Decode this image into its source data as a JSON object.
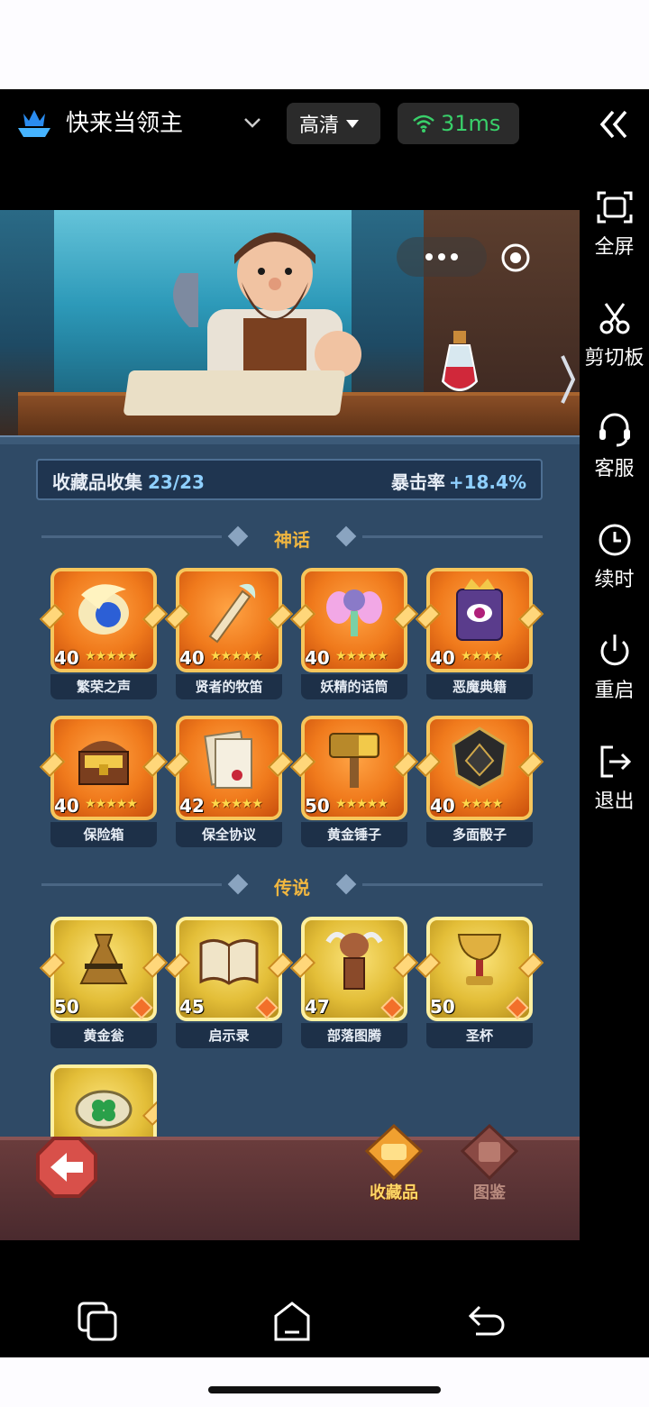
{
  "header": {
    "app_title": "快来当领主",
    "quality_label": "高清",
    "ping_label": "31ms"
  },
  "sidebar": {
    "items": [
      {
        "label": "全屏",
        "icon": "fullscreen-icon"
      },
      {
        "label": "剪切板",
        "icon": "scissors-icon"
      },
      {
        "label": "客服",
        "icon": "headset-icon"
      },
      {
        "label": "续时",
        "icon": "clock-icon"
      },
      {
        "label": "重启",
        "icon": "power-icon"
      },
      {
        "label": "退出",
        "icon": "exit-icon"
      }
    ]
  },
  "game": {
    "collection": {
      "label": "收藏品收集",
      "count": "23/23",
      "crit_label": "暴击率",
      "crit_value": "+18.4%"
    },
    "sections": {
      "mythic": "神话",
      "legend": "传说"
    },
    "mythic_items": [
      {
        "name": "繁荣之声",
        "level": "40",
        "icon": "bird-orb-icon"
      },
      {
        "name": "贤者的牧笛",
        "level": "40",
        "icon": "flute-icon"
      },
      {
        "name": "妖精的话筒",
        "level": "40",
        "icon": "fairy-mic-icon"
      },
      {
        "name": "恶魔典籍",
        "level": "40",
        "icon": "demon-book-icon"
      },
      {
        "name": "保险箱",
        "level": "40",
        "icon": "treasure-chest-icon"
      },
      {
        "name": "保全协议",
        "level": "42",
        "icon": "contract-icon"
      },
      {
        "name": "黄金锤子",
        "level": "50",
        "icon": "golden-hammer-icon"
      },
      {
        "name": "多面骰子",
        "level": "40",
        "icon": "dice-icon"
      }
    ],
    "legend_items": [
      {
        "name": "黄金瓮",
        "level": "50",
        "icon": "golden-urn-icon"
      },
      {
        "name": "启示录",
        "level": "45",
        "icon": "open-book-icon"
      },
      {
        "name": "部落图腾",
        "level": "47",
        "icon": "totem-icon"
      },
      {
        "name": "圣杯",
        "level": "50",
        "icon": "grail-icon"
      }
    ],
    "stars": "★★★★★",
    "stars4": "★★★★",
    "nav": {
      "collect_label": "收藏品",
      "guide_label": "图鉴"
    }
  }
}
